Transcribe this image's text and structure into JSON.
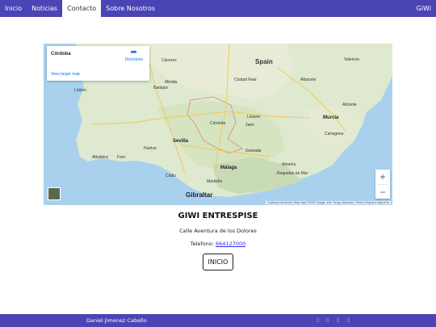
{
  "nav": {
    "items": [
      {
        "label": "Inicio"
      },
      {
        "label": "Noticias"
      },
      {
        "label": "Contacto"
      },
      {
        "label": "Sobre Nosotros"
      }
    ],
    "brand": "GiWi"
  },
  "map": {
    "place": "Córdoba",
    "directions": "Directions",
    "larger_map": "View larger map",
    "zoom_in": "+",
    "zoom_out": "−",
    "attribution": "Keyboard shortcuts | Map data ©2023 Google, Inst. Geogr. Nacional | Terms | Report a map error",
    "labels": {
      "caceres": "Cáceres",
      "spain": "Spain",
      "valencia": "Valencia",
      "lisbon": "Lisbon",
      "merida": "Mérida",
      "badajoz": "Badajoz",
      "ciudad_real": "Ciudad Real",
      "albacete": "Albacete",
      "alicante": "Alicante",
      "cordoba": "Córdoba",
      "jaen": "Jaén",
      "linares": "Linares",
      "murcia": "Murcia",
      "cartagena": "Cartagena",
      "sevilla": "Sevilla",
      "huelva": "Huelva",
      "granada": "Granada",
      "albufeira": "Albufeira",
      "faro": "Faro",
      "cadiz": "Cádiz",
      "malaga": "Málaga",
      "marbella": "Marbella",
      "almeria": "Almería",
      "roquetas": "Roquetas de Mar",
      "gibraltar": "Gibraltar"
    }
  },
  "company": {
    "name": "GIWI ENTRESPISE",
    "address": "Calle Aventura de los Dolores",
    "phone_label": "Telefono: ",
    "phone_number": "664127000",
    "button": "INICIO"
  },
  "footer": {
    "name": "Daniel Jimenez Cabello"
  }
}
